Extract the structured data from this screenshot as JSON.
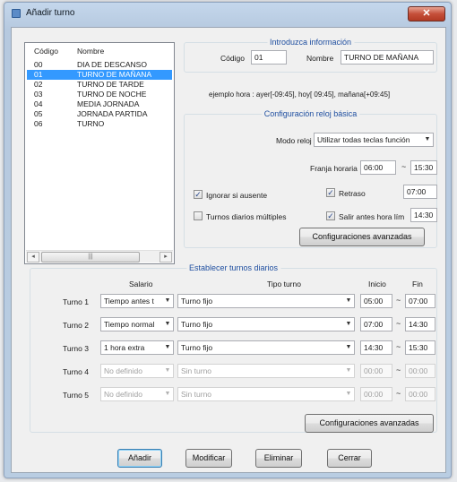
{
  "window": {
    "title": "Añadir turno",
    "close_label": "✕"
  },
  "list": {
    "headers": {
      "code": "Código",
      "name": "Nombre"
    },
    "rows": [
      {
        "code": "00",
        "name": "DIA DE DESCANSO",
        "selected": false
      },
      {
        "code": "01",
        "name": "TURNO DE MAÑANA",
        "selected": true
      },
      {
        "code": "02",
        "name": "TURNO DE TARDE",
        "selected": false
      },
      {
        "code": "03",
        "name": "TURNO DE NOCHE",
        "selected": false
      },
      {
        "code": "04",
        "name": "MEDIA JORNADA",
        "selected": false
      },
      {
        "code": "05",
        "name": "JORNADA PARTIDA",
        "selected": false
      },
      {
        "code": "06",
        "name": "TURNO",
        "selected": false
      }
    ],
    "scroll_left": "◂",
    "scroll_right": "▸",
    "scroll_thumb": "|||"
  },
  "info": {
    "title": "Introduzca información",
    "code_label": "Código",
    "code_value": "01",
    "name_label": "Nombre",
    "name_value": "TURNO DE MAÑANA",
    "example": "ejemplo hora : ayer[-09:45], hoy[ 09:45], mañana[+09:45]"
  },
  "basic": {
    "title": "Configuración reloj básica",
    "mode_label": "Modo reloj",
    "mode_value": "Utilizar todas teclas función",
    "range_label": "Franja horaria",
    "range_start": "06:00",
    "range_end": "15:30",
    "range_sep": "~",
    "ignore_label": "Ignorar si ausente",
    "ignore_checked": true,
    "delay_label": "Retraso",
    "delay_checked": true,
    "delay_value": "07:00",
    "multiple_label": "Turnos diarios múltiples",
    "multiple_checked": false,
    "early_label": "Salir antes hora lím",
    "early_checked": true,
    "early_value": "14:30",
    "advanced_label": "Configuraciones avanzadas"
  },
  "daily": {
    "title": "Establecer turnos diarios",
    "col_salary": "Salario",
    "col_type": "Tipo turno",
    "col_start": "Inicio",
    "col_end": "Fin",
    "sep": "~",
    "turns": [
      {
        "label": "Turno 1",
        "salary": "Tiempo antes t",
        "type": "Turno fijo",
        "start": "05:00",
        "end": "07:00",
        "enabled": true
      },
      {
        "label": "Turno 2",
        "salary": "Tiempo normal",
        "type": "Turno fijo",
        "start": "07:00",
        "end": "14:30",
        "enabled": true
      },
      {
        "label": "Turno 3",
        "salary": "1 hora extra",
        "type": "Turno fijo",
        "start": "14:30",
        "end": "15:30",
        "enabled": true
      },
      {
        "label": "Turno 4",
        "salary": "No definido",
        "type": "Sin turno",
        "start": "00:00",
        "end": "00:00",
        "enabled": false
      },
      {
        "label": "Turno 5",
        "salary": "No definido",
        "type": "Sin turno",
        "start": "00:00",
        "end": "00:00",
        "enabled": false
      }
    ],
    "advanced_label": "Configuraciones avanzadas"
  },
  "footer": {
    "add_label": "Añadir",
    "modify_label": "Modificar",
    "delete_label": "Eliminar",
    "close_label": "Cerrar"
  },
  "icons": {
    "combo_arrow": "▼",
    "check_mark": "✓",
    "window_icon": "app-icon"
  },
  "colors": {
    "selection": "#3399ff",
    "group_title": "#1f4fa0",
    "close_button": "#c5503a"
  }
}
